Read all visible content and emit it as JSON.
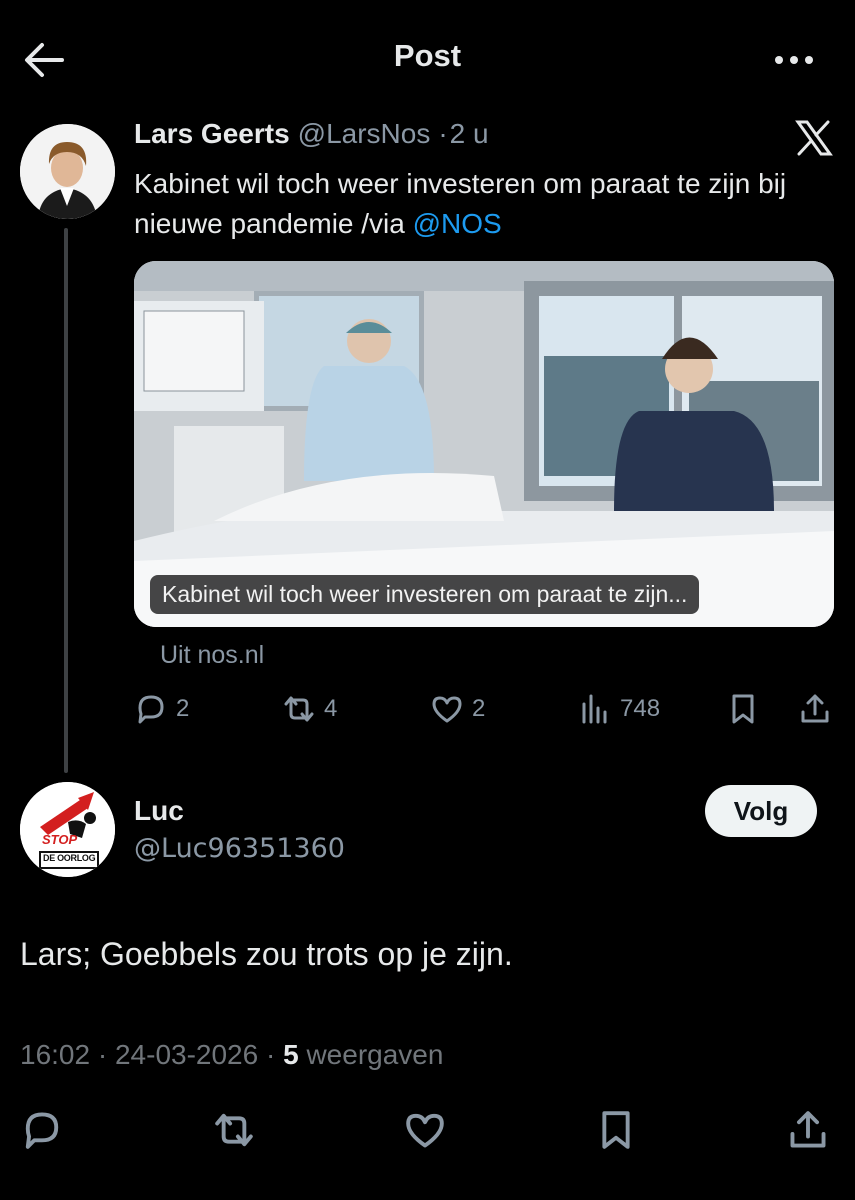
{
  "header": {
    "title": "Post",
    "back_icon": "arrow-left-icon",
    "more_icon": "more-icon"
  },
  "quoted_post": {
    "author_name": "Lars Geerts",
    "author_handle": "@LarsNos",
    "separator": "·",
    "time": "2 u",
    "text_before": "Kabinet wil toch weer investeren om paraat te zijn bij nieuwe pandemie /via ",
    "mention": "@NOS",
    "card_caption": "Kabinet wil toch weer investeren om paraat te zijn...",
    "card_source": "Uit nos.nl",
    "stats": {
      "replies": "2",
      "reposts": "4",
      "likes": "2",
      "views": "748"
    }
  },
  "reply": {
    "author_name": "Luc",
    "author_handle": "@Luc96351360",
    "follow_label": "Volg",
    "avatar_text_top": "STOP",
    "avatar_text_bottom": "DE OORLOG",
    "text": "Lars; Goebbels zou trots op je zijn.",
    "time": "16:02",
    "date": "24-03-2026",
    "views_count": "5",
    "views_label": "weergaven",
    "dot": "·"
  },
  "colors": {
    "background": "#000000",
    "text": "#e7e9ea",
    "muted": "#71767b",
    "link": "#1d9bf0"
  }
}
